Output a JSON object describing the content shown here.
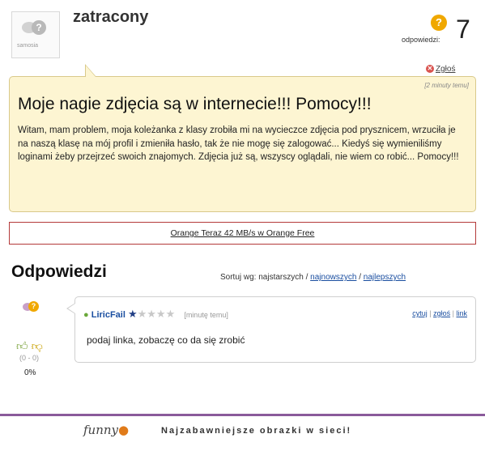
{
  "question": {
    "username": "zatracony",
    "avatar_text": "samosia",
    "answers_label": "odpowiedzi:",
    "answers_count": "7",
    "report_label": "Zgłoś",
    "time": "[2 minuty temu]",
    "title": "Moje nagie zdjęcia są w internecie!!! Pomocy!!!",
    "body": "Witam, mam problem, moja koleżanka z klasy zrobiła mi na wycieczce zdjęcia pod prysznicem, wrzuciła je na naszą klasę na mój profil i zmieniła hasło, tak że nie mogę się zalogować... Kiedyś się wymieniliśmy loginami żeby przejrzeć swoich znajomych. Zdjęcia już są, wszyscy oglądali, nie wiem co robić... Pomocy!!!"
  },
  "ad": {
    "text": "Orange Teraz 42 MB/s w Orange Free"
  },
  "answers_section": {
    "title": "Odpowiedzi",
    "sort_label": "Sortuj wg: najstarszych /",
    "sort_newest": "najnowszych",
    "sort_sep": "/",
    "sort_best": "najlepszych"
  },
  "reply": {
    "author": "LiricFail",
    "rating": 1,
    "rating_max": 5,
    "time": "[minutę temu]",
    "cite": "cytuj",
    "report": "zgłoś",
    "link": "link",
    "text": "podaj linka, zobaczę co da się zrobić",
    "votes": "(0 - 0)",
    "percent": "0%"
  },
  "footer": {
    "logo_text": "funny",
    "tagline": "Najzabawniejsze obrazki w sieci!"
  },
  "colors": {
    "link": "#1a4ea0",
    "question_bg": "#fdf5d2",
    "footer_line": "#8a5a9a",
    "accent_orange": "#f0a800"
  }
}
